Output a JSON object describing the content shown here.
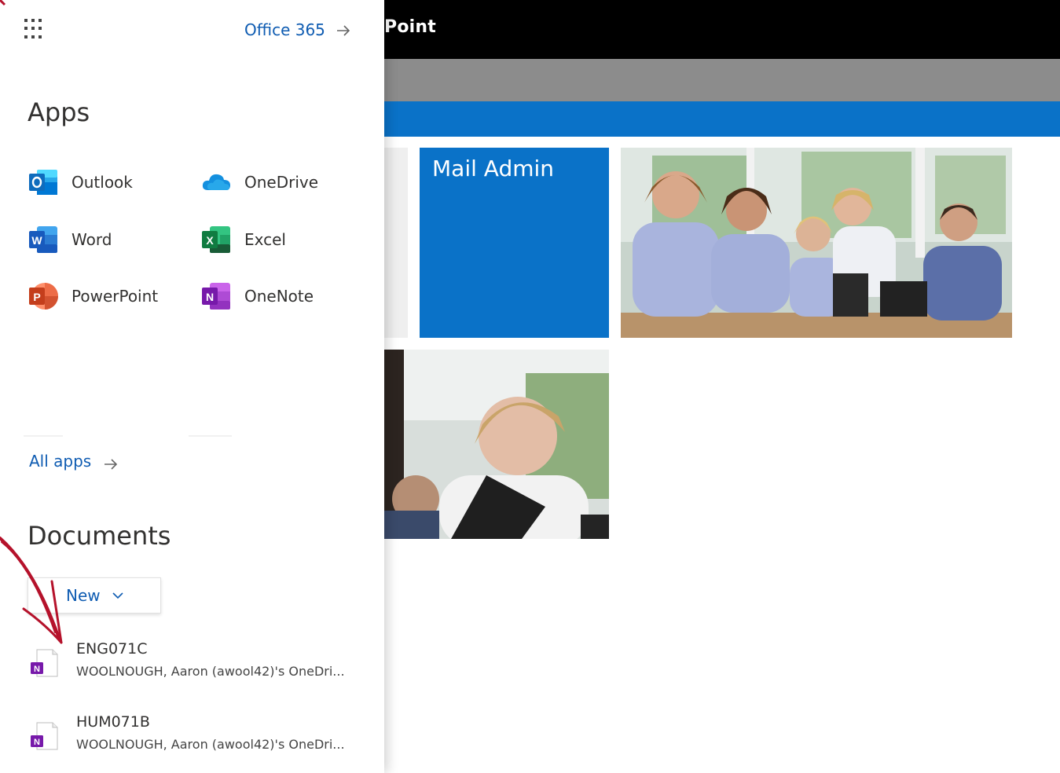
{
  "topbar": {
    "title": "Point"
  },
  "tiles": {
    "mail_admin": "Mail Admin"
  },
  "launcher": {
    "office_link": "Office 365",
    "apps_heading": "Apps",
    "apps": [
      {
        "label": "Outlook",
        "icon": "outlook-icon",
        "color": "#0f6cbd"
      },
      {
        "label": "OneDrive",
        "icon": "onedrive-icon",
        "color": "#1490df"
      },
      {
        "label": "Word",
        "icon": "word-icon",
        "color": "#185abd"
      },
      {
        "label": "Excel",
        "icon": "excel-icon",
        "color": "#107c41"
      },
      {
        "label": "PowerPoint",
        "icon": "powerpoint-icon",
        "color": "#c43e1c"
      },
      {
        "label": "OneNote",
        "icon": "onenote-icon",
        "color": "#7719aa"
      }
    ],
    "all_apps": "All apps",
    "documents_heading": "Documents",
    "new_button": "New",
    "documents": [
      {
        "name": "ENG071C",
        "location": "WOOLNOUGH, Aaron (awool42)'s OneDri..."
      },
      {
        "name": "HUM071B",
        "location": "WOOLNOUGH, Aaron (awool42)'s OneDri..."
      }
    ]
  },
  "colors": {
    "accent_link": "#0f5cb2",
    "sharepoint_blue": "#0a72c8",
    "annotation": "#b5122b"
  }
}
